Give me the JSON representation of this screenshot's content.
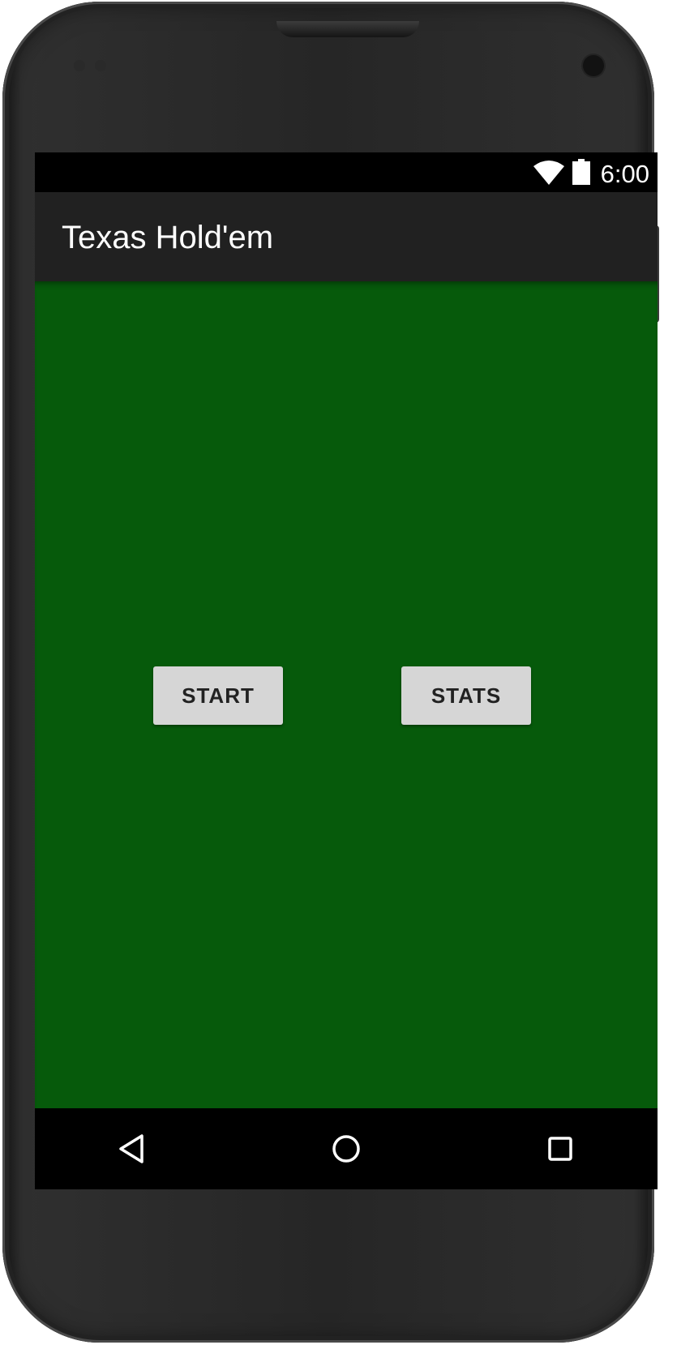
{
  "status_bar": {
    "time": "6:00",
    "icons": [
      "wifi-icon",
      "battery-icon"
    ]
  },
  "app_bar": {
    "title": "Texas Hold'em"
  },
  "main": {
    "start_label": "START",
    "stats_label": "STATS",
    "background_color": "#065a0b"
  },
  "nav_bar": {
    "icons": [
      "back-icon",
      "home-icon",
      "recents-icon"
    ]
  },
  "colors": {
    "app_bar": "#212121",
    "button": "#d6d6d6",
    "table_green": "#065a0b"
  }
}
